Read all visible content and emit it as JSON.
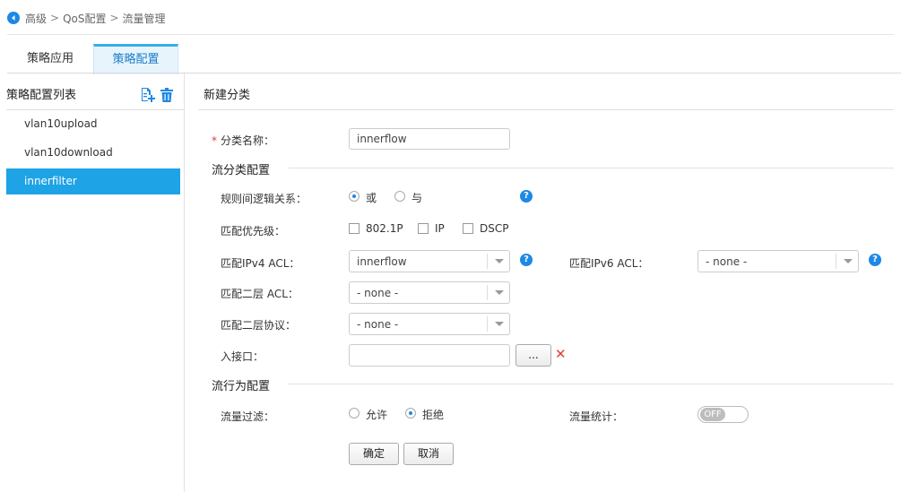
{
  "breadcrumb": {
    "items": [
      "高级",
      "QoS配置",
      "流量管理"
    ],
    "separator": ">"
  },
  "tabs": [
    {
      "label": "策略应用",
      "active": false
    },
    {
      "label": "策略配置",
      "active": true
    }
  ],
  "left_panel": {
    "title": "策略配置列表",
    "icons": [
      "add-file-icon",
      "trash-icon"
    ],
    "items": [
      {
        "label": "vlan10upload",
        "active": false
      },
      {
        "label": "vlan10download",
        "active": false
      },
      {
        "label": "innerfilter",
        "active": true
      }
    ]
  },
  "form": {
    "title": "新建分类",
    "class_name": {
      "required_mark": "*",
      "label": "分类名称：",
      "value": "innerflow"
    },
    "classification_section": "流分类配置",
    "logic": {
      "label": "规则间逻辑关系：",
      "options": [
        "或",
        "与"
      ],
      "selected": "或"
    },
    "priority": {
      "label": "匹配优先级：",
      "options": [
        "802.1P",
        "IP",
        "DSCP"
      ],
      "checked": []
    },
    "ipv4_acl": {
      "label": "匹配IPv4 ACL：",
      "value": "innerflow"
    },
    "ipv6_acl": {
      "label": "匹配IPv6 ACL：",
      "value": "- none -"
    },
    "l2_acl": {
      "label": "匹配二层 ACL：",
      "value": "- none -"
    },
    "l2_protocol": {
      "label": "匹配二层协议：",
      "value": "- none -"
    },
    "ingress": {
      "label": "入接口：",
      "value": "",
      "browse_label": "...",
      "clear_symbol": "✕"
    },
    "behavior_section": "流行为配置",
    "filter": {
      "label": "流量过滤：",
      "options": [
        "允许",
        "拒绝"
      ],
      "selected": "拒绝"
    },
    "stats": {
      "label": "流量统计：",
      "toggle": "OFF"
    },
    "buttons": {
      "ok": "确定",
      "cancel": "取消"
    }
  },
  "colors": {
    "accent": "#1ea3e6",
    "help": "#1e88e5",
    "required": "#e53935",
    "clear": "#e53935"
  }
}
